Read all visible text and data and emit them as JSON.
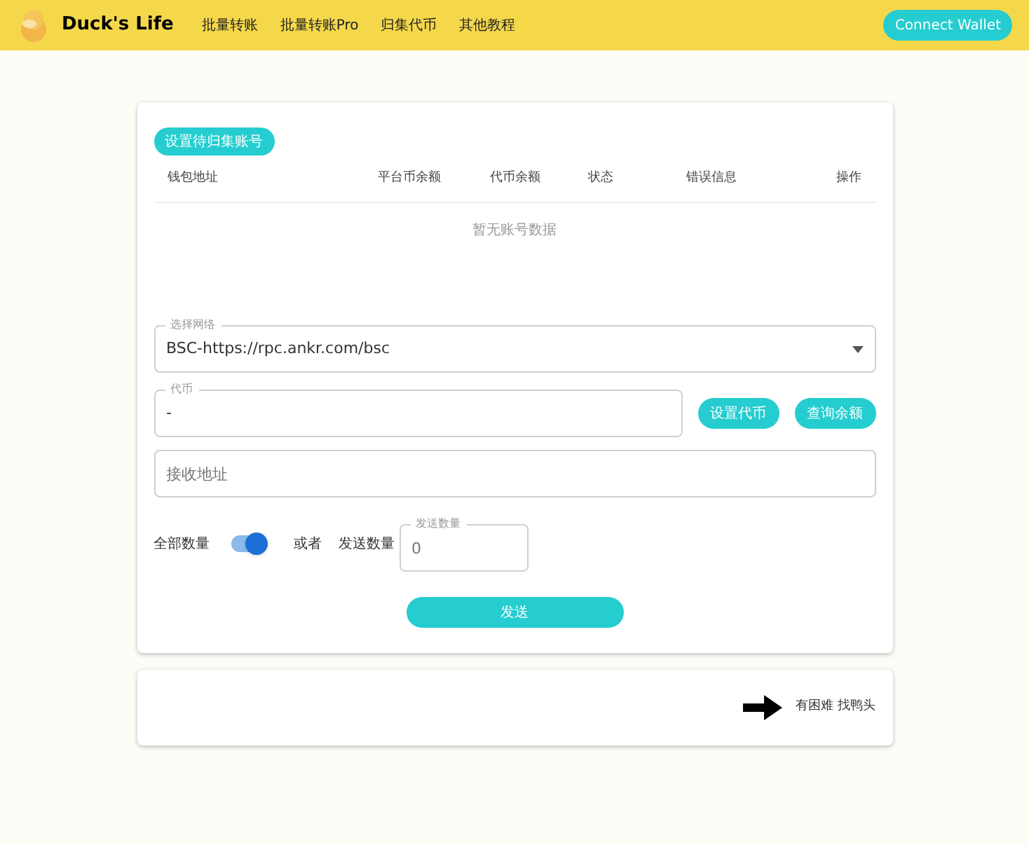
{
  "header": {
    "brand": "Duck's Life",
    "nav": [
      "批量转账",
      "批量转账Pro",
      "归集代币",
      "其他教程"
    ],
    "connect_button": "Connect Wallet"
  },
  "accounts": {
    "set_button": "设置待归集账号",
    "columns": [
      "钱包地址",
      "平台币余额",
      "代币余额",
      "状态",
      "错误信息",
      "操作"
    ],
    "empty_text": "暂无账号数据"
  },
  "network": {
    "label": "选择网络",
    "value": "BSC-https://rpc.ankr.com/bsc"
  },
  "token": {
    "label": "代币",
    "value": "-",
    "buttons": [
      "设置代币",
      "查询余额"
    ]
  },
  "receiver": {
    "placeholder": "接收地址"
  },
  "amount": {
    "all_label": "全部数量",
    "all_on": true,
    "or_text": "或者",
    "send_label": "发送数量",
    "field_label": "发送数量",
    "field_placeholder": "0"
  },
  "send_button": "发送",
  "help": {
    "text": "有困难 找鸭头"
  }
}
